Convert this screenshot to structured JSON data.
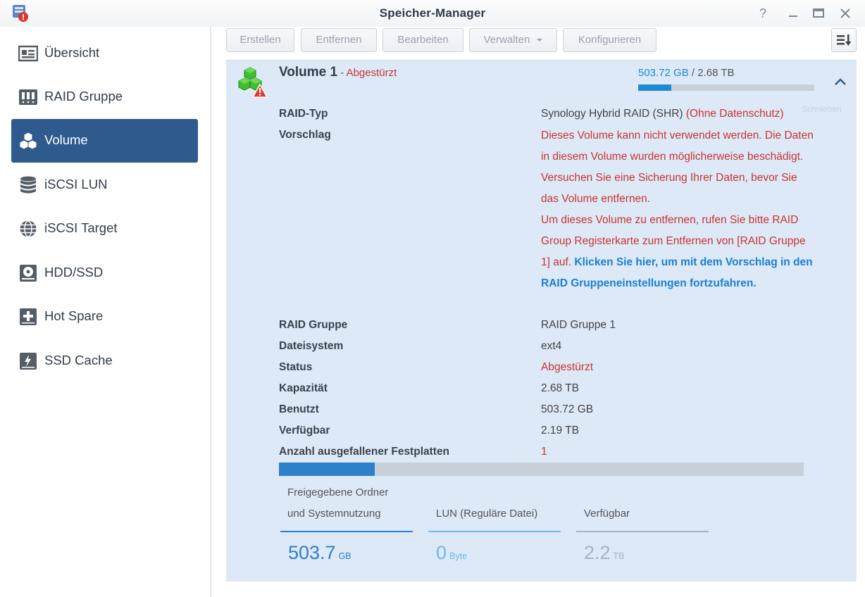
{
  "window": {
    "title": "Speicher-Manager"
  },
  "sidebar": {
    "items": [
      {
        "label": "Übersicht",
        "icon": "overview-icon",
        "active": false
      },
      {
        "label": "RAID Gruppe",
        "icon": "raid-icon",
        "active": false
      },
      {
        "label": "Volume",
        "icon": "cubes-icon",
        "active": true
      },
      {
        "label": "iSCSI LUN",
        "icon": "database-icon",
        "active": false
      },
      {
        "label": "iSCSI Target",
        "icon": "globe-icon",
        "active": false
      },
      {
        "label": "HDD/SSD",
        "icon": "disk-icon",
        "active": false
      },
      {
        "label": "Hot Spare",
        "icon": "plus-box-icon",
        "active": false
      },
      {
        "label": "SSD Cache",
        "icon": "cache-icon",
        "active": false
      }
    ]
  },
  "toolbar": {
    "create": "Erstellen",
    "remove": "Entfernen",
    "edit": "Bearbeiten",
    "manage": "Verwalten",
    "configure": "Konfigurieren"
  },
  "volume": {
    "name": "Volume 1",
    "separator": " - ",
    "status_short": "Abgestürzt",
    "used": "503.72 GB",
    "total_sep": " / ",
    "total": "2.68 TB",
    "usage_fraction": 0.188
  },
  "ghost_text": "Schnieben",
  "details": {
    "raid_type_label": "RAID-Typ",
    "raid_type_value": "Synology Hybrid RAID (SHR)",
    "raid_type_note": "(Ohne Datenschutz)",
    "suggestion_label": "Vorschlag",
    "suggestion_text1": "Dieses Volume kann nicht verwendet werden. Die Daten in diesem Volume wurden möglicherweise beschädigt. Versuchen Sie eine Sicherung Ihrer Daten, bevor Sie das Volume entfernen.",
    "suggestion_text2": "Um dieses Volume zu entfernen, rufen Sie bitte RAID Group Registerkarte zum Entfernen von [RAID Gruppe 1] auf. ",
    "suggestion_link": "Klicken Sie hier, um mit dem Vorschlag in den RAID Gruppeneinstellungen fortzufahren.",
    "raid_group_label": "RAID Gruppe",
    "raid_group_value": "RAID Gruppe 1",
    "filesystem_label": "Dateisystem",
    "filesystem_value": "ext4",
    "status_label": "Status",
    "status_value": "Abgestürzt",
    "capacity_label": "Kapazität",
    "capacity_value": "2.68 TB",
    "used_label": "Benutzt",
    "used_value": "503.72 GB",
    "available_label": "Verfügbar",
    "available_value": "2.19 TB",
    "failed_disks_label": "Anzahl ausgefallener Festplatten",
    "failed_disks_value": "1"
  },
  "usage_bar": {
    "fraction": 0.183
  },
  "stats": [
    {
      "label_line1": "Freigegebene Ordner",
      "label_line2": "und Systemnutzung",
      "value": "503.7",
      "unit": "GB",
      "color": "#2d7fcc"
    },
    {
      "label_line1": "",
      "label_line2": "LUN (Reguläre Datei)",
      "value": "0",
      "unit": "Byte",
      "color": "#6fb6ea"
    },
    {
      "label_line1": "",
      "label_line2": "Verfügbar",
      "value": "2.2",
      "unit": "TB",
      "color": "#aab2bb"
    }
  ]
}
